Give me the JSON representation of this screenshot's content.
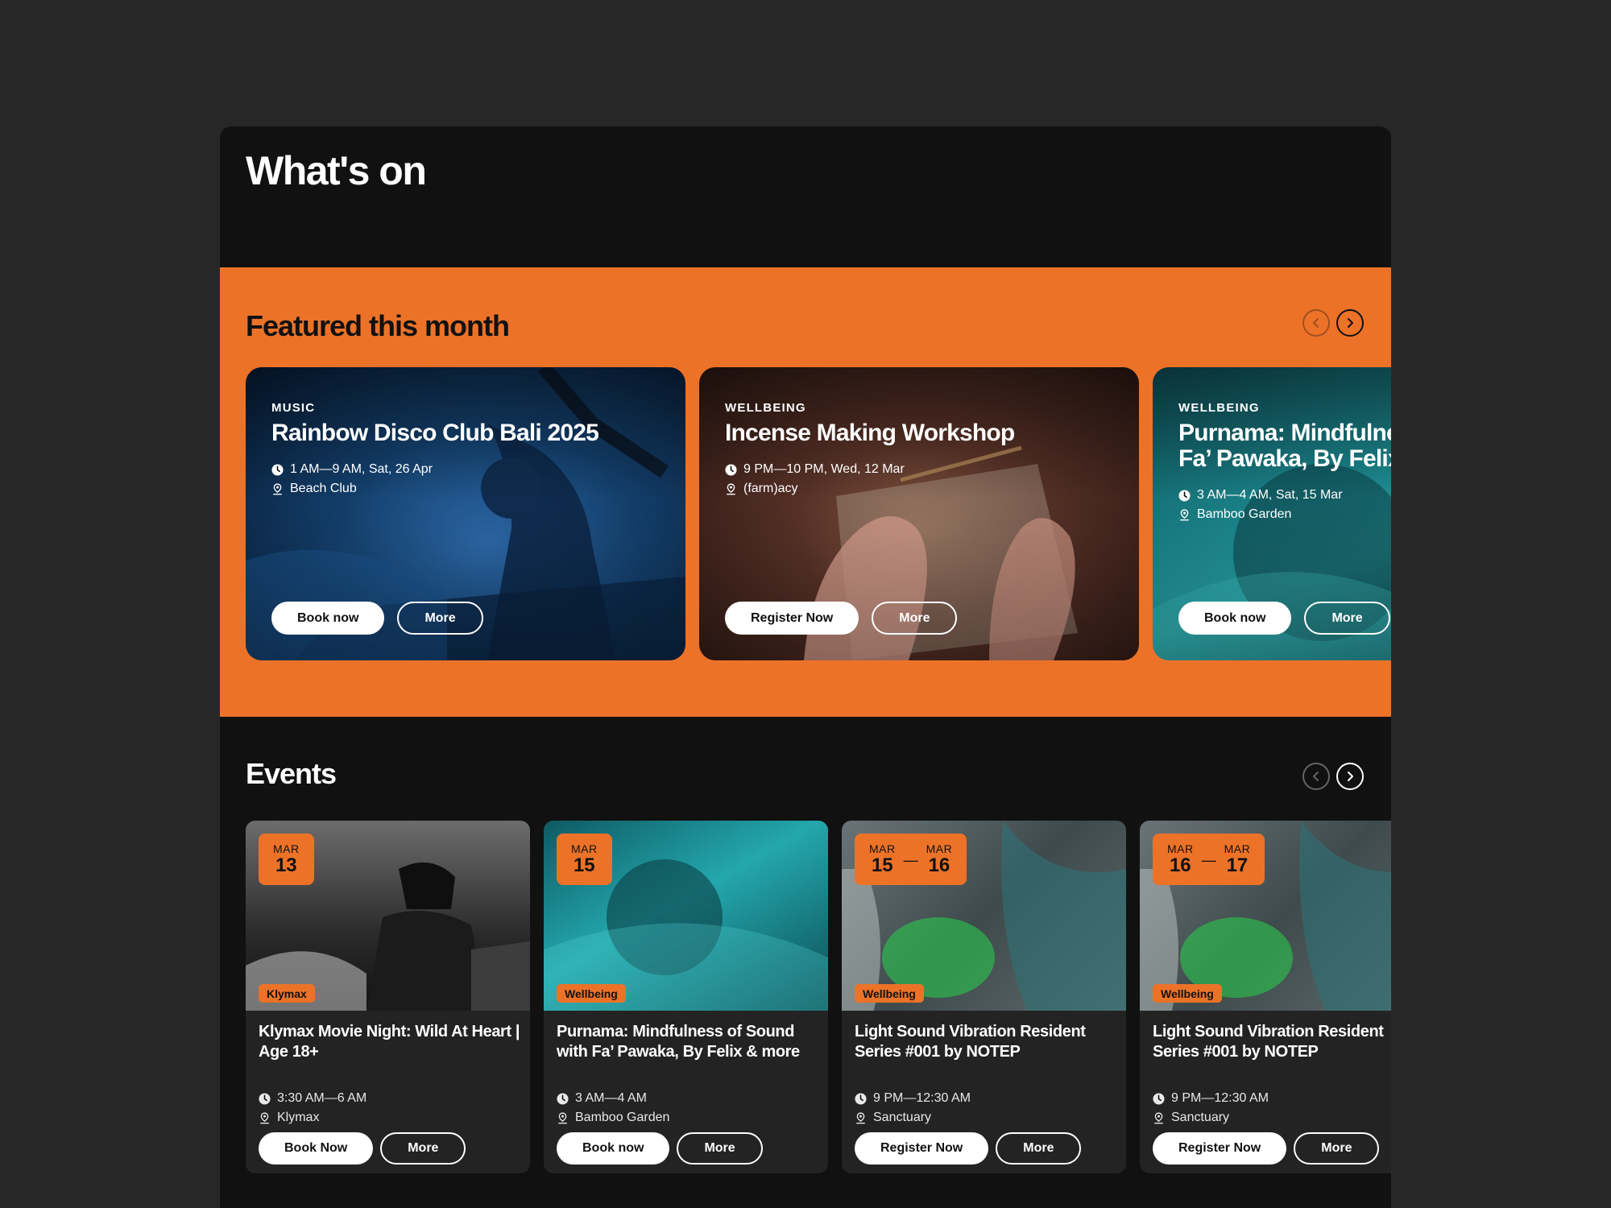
{
  "page": {
    "title": "What's on"
  },
  "featured": {
    "title": "Featured this month",
    "cards": [
      {
        "category": "MUSIC",
        "title": "Rainbow Disco Club Bali 2025",
        "time": "1 AM—9 AM, Sat, 26 Apr",
        "location": "Beach Club",
        "primary_label": "Book now",
        "secondary_label": "More"
      },
      {
        "category": "WELLBEING",
        "title": "Incense Making Workshop",
        "time": "9 PM—10 PM, Wed, 12 Mar",
        "location": "(farm)acy",
        "primary_label": "Register Now",
        "secondary_label": "More"
      },
      {
        "category": "WELLBEING",
        "title": "Purnama: Mindfulness of Sound with Fa’ Pawaka, By Felix & more",
        "time": "3 AM—4 AM, Sat, 15 Mar",
        "location": "Bamboo Garden",
        "primary_label": "Book now",
        "secondary_label": "More"
      }
    ]
  },
  "events": {
    "title": "Events",
    "cards": [
      {
        "start_month": "MAR",
        "start_day": "13",
        "tag": "Klymax",
        "title": "Klymax Movie Night: Wild At Heart | Age 18+",
        "time": "3:30 AM—6 AM",
        "location": "Klymax",
        "primary_label": "Book Now",
        "secondary_label": "More"
      },
      {
        "start_month": "MAR",
        "start_day": "15",
        "tag": "Wellbeing",
        "title": "Purnama: Mindfulness of Sound with Fa’ Pawaka, By Felix & more",
        "time": "3 AM—4 AM",
        "location": "Bamboo Garden",
        "primary_label": "Book now",
        "secondary_label": "More"
      },
      {
        "start_month": "MAR",
        "start_day": "15",
        "end_month": "MAR",
        "end_day": "16",
        "tag": "Wellbeing",
        "title": "Light Sound Vibration Resident Series #001 by NOTEP",
        "time": "9 PM—12:30 AM",
        "location": "Sanctuary",
        "primary_label": "Register Now",
        "secondary_label": "More"
      },
      {
        "start_month": "MAR",
        "start_day": "16",
        "end_month": "MAR",
        "end_day": "17",
        "tag": "Wellbeing",
        "title": "Light Sound Vibration Resident Series #001 by NOTEP",
        "time": "9 PM—12:30 AM",
        "location": "Sanctuary",
        "primary_label": "Register Now",
        "secondary_label": "More"
      }
    ]
  },
  "colors": {
    "accent": "#EC7228",
    "panel": "#111111",
    "background": "#272727",
    "card": "#232323"
  },
  "icons": {
    "prev": "chevron-left-icon",
    "next": "chevron-right-icon",
    "time": "clock-icon",
    "location": "map-pin-icon"
  }
}
